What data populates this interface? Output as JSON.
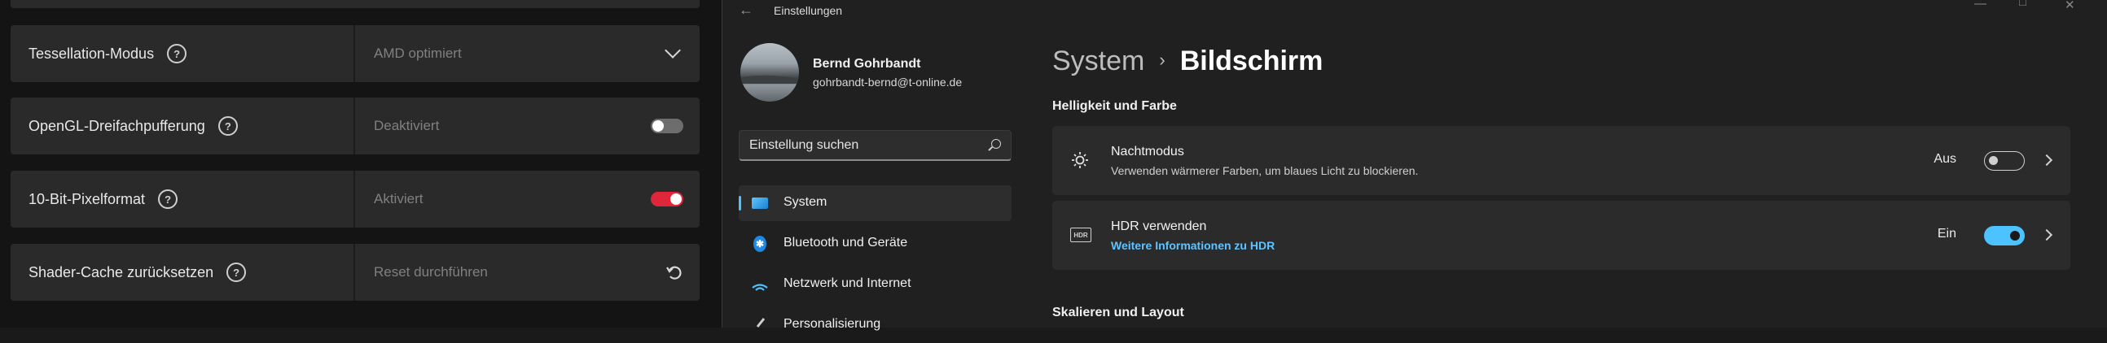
{
  "amd_panel": {
    "rows": [
      {
        "label": "Tessellation-Modus",
        "value": "AMD optimiert",
        "control": "dropdown"
      },
      {
        "label": "OpenGL-Dreifachpufferung",
        "value": "Deaktiviert",
        "control": "toggle-off"
      },
      {
        "label": "10-Bit-Pixelformat",
        "value": "Aktiviert",
        "control": "toggle-on"
      },
      {
        "label": "Shader-Cache zurücksetzen",
        "value": "Reset durchführen",
        "control": "reset"
      }
    ],
    "help_glyph": "?",
    "accent_color": "#e0263a",
    "icons": {
      "help": "help-circle-icon",
      "dropdown": "chevron-down-icon",
      "reset": "reset-icon"
    }
  },
  "settings_window": {
    "title": "Einstellungen",
    "window_controls": {
      "minimize": "—",
      "maximize": "□",
      "close": "✕"
    },
    "user": {
      "name": "Bernd Gohrbandt",
      "email": "gohrbandt-bernd@t-online.de"
    },
    "search": {
      "placeholder": "Einstellung suchen"
    },
    "nav": [
      {
        "label": "System",
        "icon": "system-display-icon",
        "active": true
      },
      {
        "label": "Bluetooth und Geräte",
        "icon": "bluetooth-icon",
        "active": false
      },
      {
        "label": "Netzwerk und Internet",
        "icon": "wifi-icon",
        "active": false
      },
      {
        "label": "Personalisierung",
        "icon": "brush-icon",
        "active": false
      }
    ],
    "breadcrumb": {
      "parent": "System",
      "separator": "›",
      "current": "Bildschirm"
    },
    "sections": {
      "brightness": "Helligkeit und Farbe",
      "scale": "Skalieren und Layout"
    },
    "cards": {
      "night": {
        "title": "Nachtmodus",
        "subtitle": "Verwenden wärmerer Farben, um blaues Licht zu blockieren.",
        "state": "Aus",
        "icon": "brightness-icon"
      },
      "hdr": {
        "title": "HDR verwenden",
        "link": "Weitere Informationen zu HDR",
        "state": "Ein",
        "icon": "hdr-icon",
        "icon_text": "HDR"
      }
    },
    "accent_color": "#4cc2ff"
  }
}
